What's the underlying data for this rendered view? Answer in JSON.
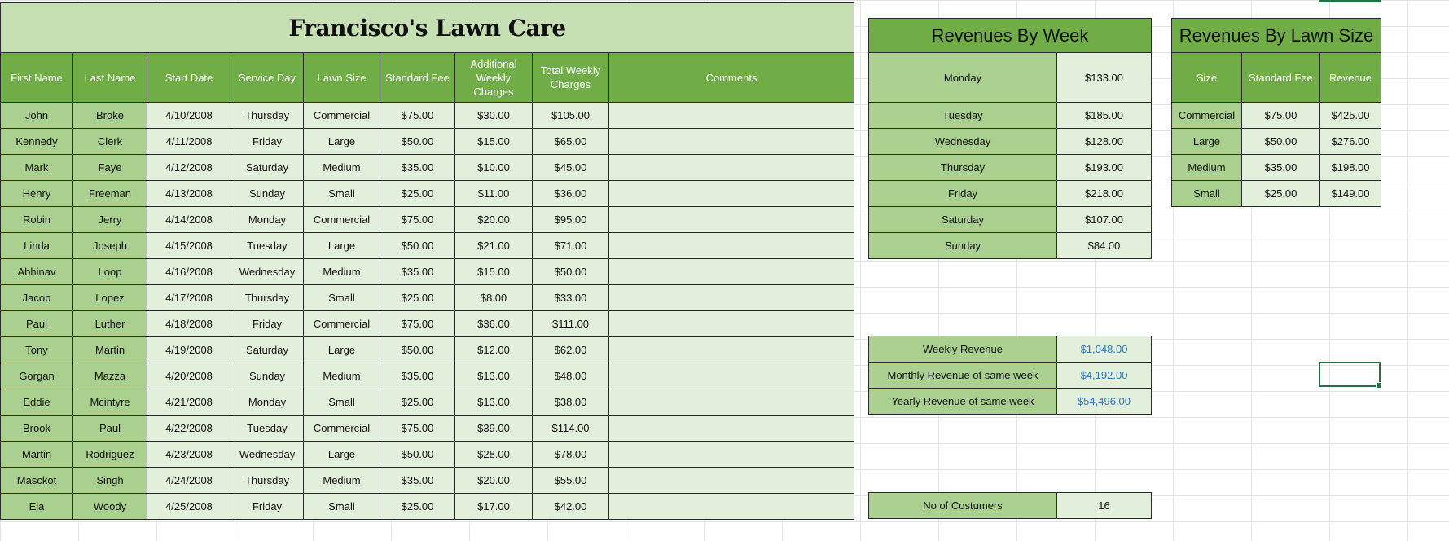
{
  "main": {
    "title": "Francisco's Lawn Care",
    "headers": [
      "First Name",
      "Last Name",
      "Start Date",
      "Service Day",
      "Lawn  Size",
      "Standard Fee",
      "Additional Weekly Charges",
      "Total Weekly Charges",
      "Comments"
    ],
    "rows": [
      [
        "John",
        "Broke",
        "4/10/2008",
        "Thursday",
        "Commercial",
        "$75.00",
        "$30.00",
        "$105.00",
        ""
      ],
      [
        "Kennedy",
        "Clerk",
        "4/11/2008",
        "Friday",
        "Large",
        "$50.00",
        "$15.00",
        "$65.00",
        ""
      ],
      [
        "Mark",
        "Faye",
        "4/12/2008",
        "Saturday",
        "Medium",
        "$35.00",
        "$10.00",
        "$45.00",
        ""
      ],
      [
        "Henry",
        "Freeman",
        "4/13/2008",
        "Sunday",
        "Small",
        "$25.00",
        "$11.00",
        "$36.00",
        ""
      ],
      [
        "Robin",
        "Jerry",
        "4/14/2008",
        "Monday",
        "Commercial",
        "$75.00",
        "$20.00",
        "$95.00",
        ""
      ],
      [
        "Linda",
        "Joseph",
        "4/15/2008",
        "Tuesday",
        "Large",
        "$50.00",
        "$21.00",
        "$71.00",
        ""
      ],
      [
        "Abhinav",
        "Loop",
        "4/16/2008",
        "Wednesday",
        "Medium",
        "$35.00",
        "$15.00",
        "$50.00",
        ""
      ],
      [
        "Jacob",
        "Lopez",
        "4/17/2008",
        "Thursday",
        "Small",
        "$25.00",
        "$8.00",
        "$33.00",
        ""
      ],
      [
        "Paul",
        "Luther",
        "4/18/2008",
        "Friday",
        "Commercial",
        "$75.00",
        "$36.00",
        "$111.00",
        ""
      ],
      [
        "Tony",
        "Martin",
        "4/19/2008",
        "Saturday",
        "Large",
        "$50.00",
        "$12.00",
        "$62.00",
        ""
      ],
      [
        "Gorgan",
        "Mazza",
        "4/20/2008",
        "Sunday",
        "Medium",
        "$35.00",
        "$13.00",
        "$48.00",
        ""
      ],
      [
        "Eddie",
        "Mcintyre",
        "4/21/2008",
        "Monday",
        "Small",
        "$25.00",
        "$13.00",
        "$38.00",
        ""
      ],
      [
        "Brook",
        "Paul",
        "4/22/2008",
        "Tuesday",
        "Commercial",
        "$75.00",
        "$39.00",
        "$114.00",
        ""
      ],
      [
        "Martin",
        "Rodriguez",
        "4/23/2008",
        "Wednesday",
        "Large",
        "$50.00",
        "$28.00",
        "$78.00",
        ""
      ],
      [
        "Masckot",
        "Singh",
        "4/24/2008",
        "Thursday",
        "Medium",
        "$35.00",
        "$20.00",
        "$55.00",
        ""
      ],
      [
        "Ela",
        "Woody",
        "4/25/2008",
        "Friday",
        "Small",
        "$25.00",
        "$17.00",
        "$42.00",
        ""
      ]
    ]
  },
  "week": {
    "title": "Revenues By Week",
    "rows": [
      [
        "Monday",
        "$133.00"
      ],
      [
        "Tuesday",
        "$185.00"
      ],
      [
        "Wednesday",
        "$128.00"
      ],
      [
        "Thursday",
        "$193.00"
      ],
      [
        "Friday",
        "$218.00"
      ],
      [
        "Saturday",
        "$107.00"
      ],
      [
        "Sunday",
        "$84.00"
      ]
    ],
    "summary": [
      [
        "Weekly Revenue",
        "$1,048.00"
      ],
      [
        "Monthly Revenue of same week",
        "$4,192.00"
      ],
      [
        "Yearly Revenue of same week",
        "$54,496.00"
      ]
    ],
    "customers_label": "No of Costumers",
    "customers_value": "16"
  },
  "lawn": {
    "title": "Revenues By Lawn Size",
    "headers": [
      "Size",
      "Standard Fee",
      "Revenue"
    ],
    "rows": [
      [
        "Commercial",
        "$75.00",
        "$425.00"
      ],
      [
        "Large",
        "$50.00",
        "$276.00"
      ],
      [
        "Medium",
        "$35.00",
        "$198.00"
      ],
      [
        "Small",
        "$25.00",
        "$149.00"
      ]
    ]
  },
  "colors": {
    "header": "#70ad47",
    "name": "#a9d08e",
    "cell": "#e2efda",
    "title": "#c6e0b4",
    "link": "#2e75b6"
  }
}
